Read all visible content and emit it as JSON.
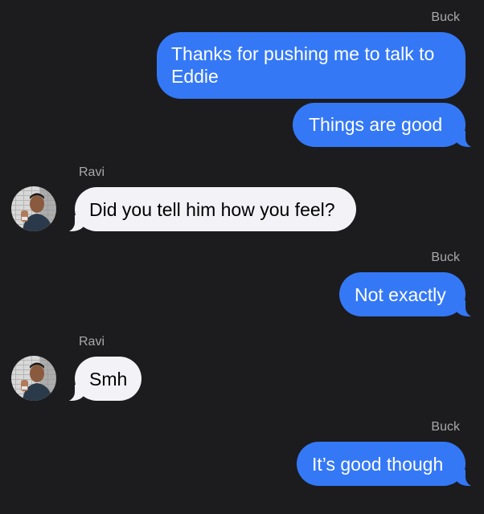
{
  "conversation": {
    "messages": [
      {
        "sender": "Buck",
        "direction": "outgoing",
        "text": "Thanks for pushing me to talk to Eddie"
      },
      {
        "sender": "Buck",
        "direction": "outgoing",
        "text": "Things are good"
      },
      {
        "sender": "Ravi",
        "direction": "incoming",
        "text": "Did you tell him how you feel?"
      },
      {
        "sender": "Buck",
        "direction": "outgoing",
        "text": "Not exactly"
      },
      {
        "sender": "Ravi",
        "direction": "incoming",
        "text": "Smh"
      },
      {
        "sender": "Buck",
        "direction": "outgoing",
        "text": "It’s good though"
      }
    ],
    "sender_labels": [
      "Buck",
      "Ravi",
      "Buck",
      "Ravi",
      "Buck"
    ]
  },
  "colors": {
    "background": "#1c1c1e",
    "outgoing_bubble": "#3478f6",
    "incoming_bubble": "#f2f2f7",
    "sender_label": "#a8a8ad"
  },
  "icons": {
    "contact_avatar": "ravi-avatar-photo"
  }
}
